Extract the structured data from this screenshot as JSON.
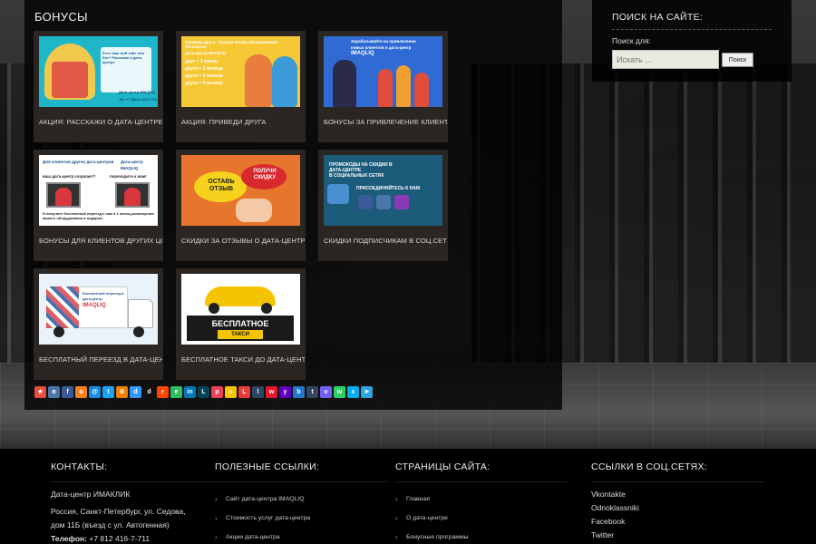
{
  "page": {
    "section_title": "БОНУСЫ"
  },
  "cards": [
    {
      "caption": "АКЦИЯ: РАССКАЖИ О ДАТА-ЦЕНТРЕ",
      "thumb_lines": [
        "Есть ваш мой сайт или бот? Расскажи о дата-центре",
        "Дата-центр IMAQLIQ",
        "Tel: +7 (812) 416-7-711"
      ]
    },
    {
      "caption": "АКЦИЯ: ПРИВЕДИ ДРУГА",
      "thumb_lines": [
        "Приведи друга - получи месяц обслуживания бесплатно",
        "Дата-центр IMAQLIQ",
        "друг = 1 месяц",
        "друга = 2 месяца",
        "друга = 3 месяца",
        "друга = 4 месяца"
      ]
    },
    {
      "caption": "БОНУСЫ ЗА ПРИВЛЕЧЕНИЕ КЛИЕНТОВ",
      "thumb_lines": [
        "Зарабатывайте на привлечении",
        "новых клиентов в дата-центр",
        "IMAQLIQ"
      ]
    },
    {
      "caption": "БОНУСЫ ДЛЯ КЛИЕНТОВ ДРУГИХ ЦОД",
      "thumb_lines": [
        "Для клиентов других дата-центров",
        "Дата-центр IMAQLIQ",
        "ваш дата-центр огорчает?",
        "переходите к нам!",
        "И получите бесплатный переезд к нам и 1 месяц размещения вашего оборудования в подарок!"
      ]
    },
    {
      "caption": "СКИДКИ ЗА ОТЗЫВЫ О ДАТА-ЦЕНТРЕ",
      "thumb_lines": [
        "ОСТАВЬ ОТЗЫВ",
        "ПОЛУЧИ СКИДКУ"
      ]
    },
    {
      "caption": "СКИДКИ ПОДПИСЧИКАМ В СОЦ.СЕТЯХ",
      "thumb_lines": [
        "ПРОМОКОДЫ НА СКИДКИ В ДАТА-ЦЕНТРЕ",
        "ПРИСОЕДИНЯЙТЕСЬ К НАМ",
        "В СОЦИАЛЬНЫХ СЕТЯХ"
      ]
    },
    {
      "caption": "БЕСПЛАТНЫЙ ПЕРЕЕЗД В ДАТА-ЦЕНТР",
      "thumb_lines": [
        "Бесплатный переезд в",
        "дата-центр",
        "IMAQLIQ"
      ]
    },
    {
      "caption": "БЕСПЛАТНОЕ ТАКСИ ДО ДАТА-ЦЕНТРА",
      "thumb_lines": [
        "БЕСПЛАТНОЕ",
        "ТАКСИ"
      ]
    }
  ],
  "share_buttons": [
    {
      "icon": "bookmark-icon",
      "glyph": "★",
      "color": "#e74c3c"
    },
    {
      "icon": "vk-icon",
      "glyph": "в",
      "color": "#4a76a8"
    },
    {
      "icon": "facebook-icon",
      "glyph": "f",
      "color": "#3b5998"
    },
    {
      "icon": "odnoklassniki-icon",
      "glyph": "о",
      "color": "#f58220"
    },
    {
      "icon": "moimir-icon",
      "glyph": "@",
      "color": "#168de2"
    },
    {
      "icon": "twitter-icon",
      "glyph": "t",
      "color": "#1da1f2"
    },
    {
      "icon": "blogger-icon",
      "glyph": "B",
      "color": "#f57d00"
    },
    {
      "icon": "delicious-icon",
      "glyph": "d",
      "color": "#3399ff"
    },
    {
      "icon": "digg-icon",
      "glyph": "d",
      "color": "#111111"
    },
    {
      "icon": "reddit-icon",
      "glyph": "r",
      "color": "#ff4500"
    },
    {
      "icon": "evernote-icon",
      "glyph": "e",
      "color": "#2dbe60"
    },
    {
      "icon": "linkedin-icon",
      "glyph": "in",
      "color": "#0077b5"
    },
    {
      "icon": "livejournal-icon",
      "glyph": "L",
      "color": "#004359"
    },
    {
      "icon": "pocket-icon",
      "glyph": "p",
      "color": "#ef4056"
    },
    {
      "icon": "surfingbird-icon",
      "glyph": "s",
      "color": "#f6c301"
    },
    {
      "icon": "liveinternet-icon",
      "glyph": "L",
      "color": "#e73c3c"
    },
    {
      "icon": "tumblr-icon",
      "glyph": "l",
      "color": "#2c4762"
    },
    {
      "icon": "weibo-icon",
      "glyph": "w",
      "color": "#e6162d"
    },
    {
      "icon": "yahoo-icon",
      "glyph": "y",
      "color": "#5f00c0"
    },
    {
      "icon": "buffer-icon",
      "glyph": "b",
      "color": "#2478cf"
    },
    {
      "icon": "tumblr2-icon",
      "glyph": "t",
      "color": "#35465c"
    },
    {
      "icon": "viber-icon",
      "glyph": "v",
      "color": "#7360f2"
    },
    {
      "icon": "whatsapp-icon",
      "glyph": "w",
      "color": "#25d366"
    },
    {
      "icon": "skype-icon",
      "glyph": "s",
      "color": "#00aff0"
    },
    {
      "icon": "telegram-icon",
      "glyph": "➤",
      "color": "#2ca5e0"
    }
  ],
  "search": {
    "title": "ПОИСК НА САЙТЕ:",
    "label": "Поиск для:",
    "placeholder": "Искать ...",
    "button": "Поиск"
  },
  "footer": {
    "contacts": {
      "title": "КОНТАКТЫ:",
      "name": "Дата-центр ИМАКЛИК",
      "address": "Россия, Санкт-Петербург, ул. Седова, дом 11Б (въезд с ул. Автогенная)",
      "phone_label": "Телефон:",
      "phone": "+7 812 416-7-711"
    },
    "useful": {
      "title": "ПОЛЕЗНЫЕ ССЫЛКИ:",
      "items": [
        "Сайт дата-центра IMAQLIQ",
        "Стоимость услуг дата-центра",
        "Акции дата-центра"
      ]
    },
    "pages": {
      "title": "СТРАНИЦЫ САЙТА:",
      "items": [
        "Главная",
        "О дата-центре",
        "Бонусные программы"
      ]
    },
    "social": {
      "title": "ССЫЛКИ В СОЦ.СЕТЯХ:",
      "items": [
        "Vkontakte",
        "Odnoklassniki",
        "Facebook",
        "Twitter"
      ]
    }
  }
}
